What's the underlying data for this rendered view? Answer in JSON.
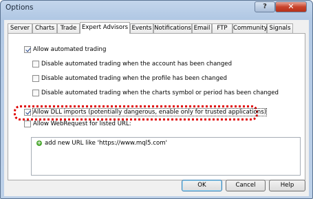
{
  "window": {
    "title": "Options",
    "help_glyph": "?",
    "close_glyph": "✕"
  },
  "tabs": [
    "Server",
    "Charts",
    "Trade",
    "Expert Advisors",
    "Events",
    "Notifications",
    "Email",
    "FTP",
    "Community",
    "Signals"
  ],
  "active_tab": "Expert Advisors",
  "options": {
    "allow_automated_trading": {
      "label": "Allow automated trading",
      "checked": true
    },
    "disable_account_change": {
      "label": "Disable automated trading when the account has been changed",
      "checked": false
    },
    "disable_profile_change": {
      "label": "Disable automated trading when the profile has been changed",
      "checked": false
    },
    "disable_symbol_change": {
      "label": "Disable automated trading when the charts symbol or period has been changed",
      "checked": false
    },
    "allow_dll_imports": {
      "label": "Allow DLL imports (potentially dangerous, enable only for trusted applications)",
      "checked": true
    },
    "allow_webrequest": {
      "label": "Allow WebRequest for listed URL:",
      "checked": false
    }
  },
  "url_list": {
    "add_item_label": "add new URL like 'https://www.mql5.com'",
    "add_icon": "plus-circle-icon"
  },
  "buttons": {
    "ok": "OK",
    "cancel": "Cancel",
    "help": "Help"
  },
  "colors": {
    "highlight": "#e00000",
    "title_bar": "#b9cde6"
  }
}
